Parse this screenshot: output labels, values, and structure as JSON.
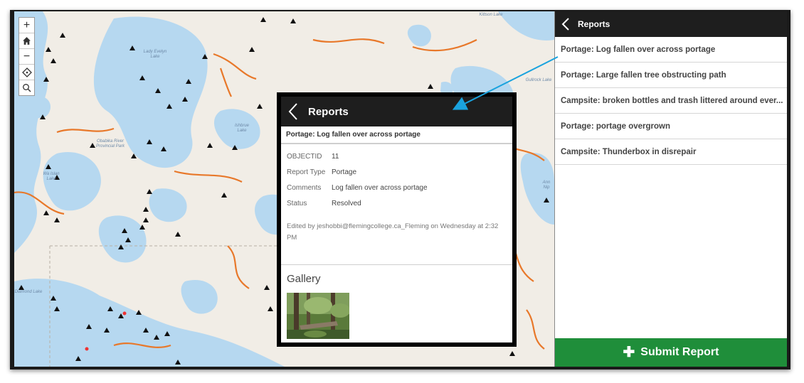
{
  "sidebar": {
    "title": "Reports",
    "items": [
      {
        "label": "Portage: Log fallen over across portage"
      },
      {
        "label": "Portage: Large fallen tree obstructing path"
      },
      {
        "label": "Campsite: broken bottles and trash littered around ever..."
      },
      {
        "label": "Portage: portage overgrown"
      },
      {
        "label": "Campsite: Thunderbox in disrepair"
      }
    ],
    "submit_label": "Submit Report",
    "submit_color": "#1f8e3a"
  },
  "popup": {
    "title": "Reports",
    "subtitle": "Portage: Log fallen over across portage",
    "fields": [
      {
        "name": "OBJECTID",
        "value": "11"
      },
      {
        "name": "Report Type",
        "value": "Portage"
      },
      {
        "name": "Comments",
        "value": "Log fallen over across portage"
      },
      {
        "name": "Status",
        "value": "Resolved"
      }
    ],
    "edited": "Edited by jeshobbi@flemingcollege.ca_Fleming on Wednesday at 2:32 PM",
    "gallery_title": "Gallery"
  },
  "map": {
    "labels": {
      "lady_evelyn": "Lady Evelyn Lake",
      "obabika": "Obabika River Provincial Park",
      "wawiagama": "Wa Islan Lake",
      "diamond": "Diamond Lake",
      "gullrock": "Gullrock Lake",
      "ishbrue": "Ishbrue Lake",
      "kittson": "Kittson Lake",
      "ann": "Ann Nip"
    },
    "controls": {
      "zoom_in": "+",
      "zoom_out": "−"
    },
    "colors": {
      "water": "#b6d8f0",
      "land": "#f1ede6",
      "roads": "#e8782a"
    }
  },
  "icons": {
    "back": "chevron-left-icon",
    "plus": "plus-icon",
    "home": "home-icon",
    "locate": "locate-icon",
    "search": "search-icon",
    "campsite": "campsite-icon"
  }
}
